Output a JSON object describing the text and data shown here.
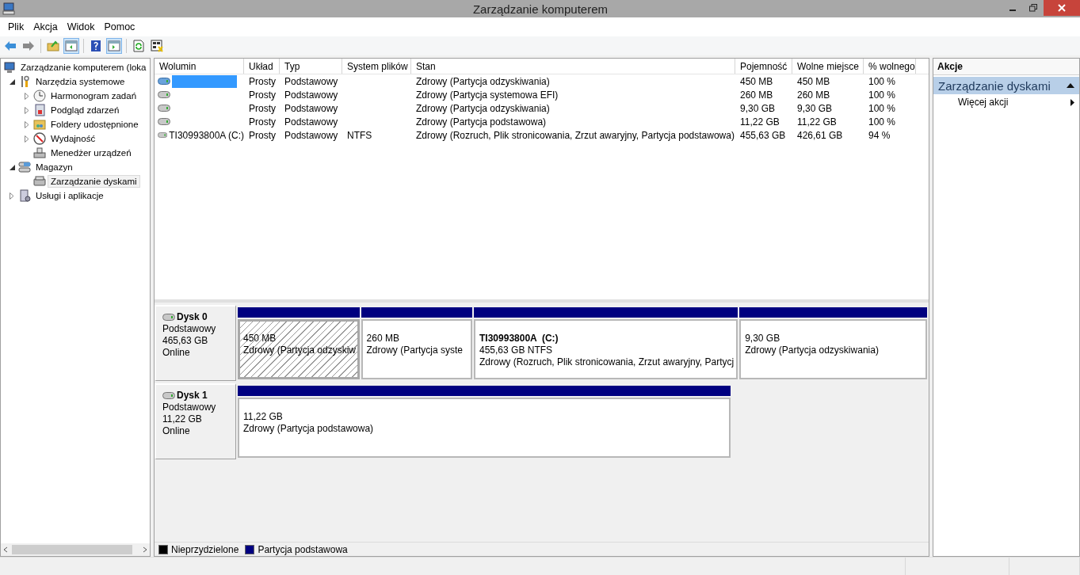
{
  "window": {
    "title": "Zarządzanie komputerem"
  },
  "menu": [
    "Plik",
    "Akcja",
    "Widok",
    "Pomoc"
  ],
  "toolbar": [
    {
      "kind": "back",
      "pressed": false
    },
    {
      "kind": "forward",
      "pressed": false
    },
    {
      "kind": "sep"
    },
    {
      "kind": "up",
      "pressed": false
    },
    {
      "kind": "tree",
      "pressed": true
    },
    {
      "kind": "sep"
    },
    {
      "kind": "help",
      "pressed": false
    },
    {
      "kind": "actionpane",
      "pressed": true
    },
    {
      "kind": "sep"
    },
    {
      "kind": "refresh",
      "pressed": false
    },
    {
      "kind": "export",
      "pressed": false
    }
  ],
  "tree": [
    {
      "label": "Zarządzanie komputerem (loka",
      "kind": "computer",
      "selected": false,
      "children": [
        {
          "label": "Narzędzia systemowe",
          "kind": "tools",
          "expanded": true,
          "selected": false,
          "children": [
            {
              "label": "Harmonogram zadań",
              "kind": "clock",
              "expanded": false,
              "selected": false
            },
            {
              "label": "Podgląd zdarzeń",
              "kind": "log",
              "expanded": false,
              "selected": false
            },
            {
              "label": "Foldery udostępnione",
              "kind": "folder",
              "expanded": false,
              "selected": false
            },
            {
              "label": "Wydajność",
              "kind": "gauge",
              "expanded": false,
              "selected": false
            },
            {
              "label": "Menedżer urządzeń",
              "kind": "device",
              "selected": false
            }
          ]
        },
        {
          "label": "Magazyn",
          "kind": "storage",
          "expanded": true,
          "selected": false,
          "children": [
            {
              "label": "Zarządzanie dyskami",
              "kind": "disk",
              "selected": true
            }
          ]
        },
        {
          "label": "Usługi i aplikacje",
          "kind": "services",
          "expanded": false,
          "selected": false
        }
      ]
    }
  ],
  "table": {
    "columns": [
      "Wolumin",
      "Układ",
      "Typ",
      "System plików",
      "Stan",
      "Pojemność",
      "Wolne miejsce",
      "% wolnego"
    ],
    "rows": [
      {
        "selected": true,
        "cells": [
          "",
          "Prosty",
          "Podstawowy",
          "",
          "Zdrowy (Partycja odzyskiwania)",
          "450 MB",
          "450 MB",
          "100 %"
        ]
      },
      {
        "selected": false,
        "cells": [
          "",
          "Prosty",
          "Podstawowy",
          "",
          "Zdrowy (Partycja systemowa EFI)",
          "260 MB",
          "260 MB",
          "100 %"
        ]
      },
      {
        "selected": false,
        "cells": [
          "",
          "Prosty",
          "Podstawowy",
          "",
          "Zdrowy (Partycja odzyskiwania)",
          "9,30 GB",
          "9,30 GB",
          "100 %"
        ]
      },
      {
        "selected": false,
        "cells": [
          "",
          "Prosty",
          "Podstawowy",
          "",
          "Zdrowy (Partycja podstawowa)",
          "11,22 GB",
          "11,22 GB",
          "100 %"
        ]
      },
      {
        "selected": false,
        "cells": [
          "TI30993800A (C:)",
          "Prosty",
          "Podstawowy",
          "NTFS",
          "Zdrowy (Rozruch, Plik stronicowania, Zrzut awaryjny, Partycja podstawowa)",
          "455,63 GB",
          "426,61 GB",
          "94 %"
        ]
      }
    ]
  },
  "disks": [
    {
      "name": "Dysk 0",
      "type": "Podstawowy",
      "size": "465,63 GB",
      "status": "Online",
      "partitions": [
        {
          "selected": true,
          "size": "450 MB",
          "status": "Zdrowy (Partycja odzyskiw"
        },
        {
          "selected": false,
          "size": "260 MB",
          "status": "Zdrowy (Partycja syste"
        },
        {
          "selected": false,
          "label": "TI30993800A  (C:)",
          "size": "455,63 GB NTFS",
          "status": "Zdrowy (Rozruch, Plik stronicowania, Zrzut awaryjny, Partycj"
        },
        {
          "selected": false,
          "size": "9,30 GB",
          "status": "Zdrowy (Partycja odzyskiwania)"
        }
      ]
    },
    {
      "name": "Dysk 1",
      "type": "Podstawowy",
      "size": "11,22 GB",
      "status": "Online",
      "partitions": [
        {
          "selected": false,
          "size": "11,22 GB",
          "status": "Zdrowy (Partycja podstawowa)"
        }
      ]
    }
  ],
  "legend": [
    {
      "label": "Nieprzydzielone",
      "color": "#000000"
    },
    {
      "label": "Partycja podstawowa",
      "color": "#000080"
    }
  ],
  "actions": {
    "title": "Akcje",
    "section": "Zarządzanie dyskami",
    "items": [
      "Więcej akcji"
    ]
  }
}
